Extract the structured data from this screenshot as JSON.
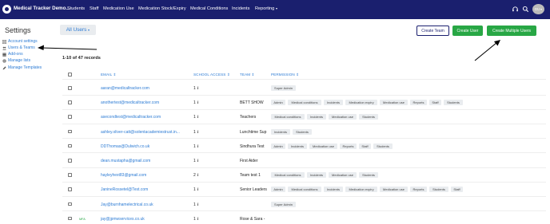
{
  "app": {
    "brand": "Medical Tracker Demo...",
    "nav": [
      "Students",
      "Staff",
      "Medication Use",
      "Medication Stock/Expiry",
      "Medical Conditions",
      "Incidents"
    ],
    "reporting": "Reporting",
    "avatar_initials": "GU"
  },
  "sidebar": {
    "title": "Settings",
    "items": [
      {
        "label": "Account settings",
        "icon": "list-icon"
      },
      {
        "label": "Users & Teams",
        "icon": "users-icon"
      },
      {
        "label": "Add-ons",
        "icon": "addons-icon"
      },
      {
        "label": "Manage lists",
        "icon": "gear-icon"
      },
      {
        "label": "Manage Templates",
        "icon": "pencil-icon"
      }
    ]
  },
  "filter": {
    "label": "All Users"
  },
  "actions": {
    "create_team": "Create Team",
    "create_user": "Create User",
    "create_multiple": "Create Multiple Users"
  },
  "record_count": "1-10 of 47 records",
  "table": {
    "headers": [
      "EMAIL",
      "SCHOOL ACCESS",
      "TEAM",
      "PERMISSION"
    ],
    "rows": [
      {
        "email": "aaran@medicaltracker.com",
        "access": "1",
        "team": "",
        "mfa": "",
        "perms": [
          "Super Admin"
        ]
      },
      {
        "email": "anothertest@medicaltracker.com",
        "access": "1",
        "team": "BETT SHOW",
        "mfa": "",
        "perms": [
          "Admin",
          "Medical conditions",
          "Incidents",
          "Medication expiry",
          "Medication use",
          "Reports",
          "Staff",
          "Students"
        ]
      },
      {
        "email": "asecondtest@medicaltracker.com",
        "access": "1",
        "team": "Teachers",
        "mfa": "",
        "perms": [
          "Medical conditions",
          "Incidents",
          "Medication use",
          "Students"
        ]
      },
      {
        "email": "ashley.oliver-catt@solentacademiestrust.in...",
        "access": "1",
        "team": "Lunchtime Sup",
        "mfa": "",
        "perms": [
          "Incidents",
          "Students"
        ]
      },
      {
        "email": "DDThomas@Dulwich.co.uk",
        "access": "1",
        "team": "Sindhura Test",
        "mfa": "",
        "perms": [
          "Admin",
          "Incidents",
          "Medication use",
          "Reports",
          "Staff",
          "Students"
        ]
      },
      {
        "email": "dean.mustapha@gmail.com",
        "access": "1",
        "team": "First Aider",
        "mfa": "",
        "perms": []
      },
      {
        "email": "hayleyhext83@gmail.com",
        "access": "2",
        "team": "Team test 1",
        "mfa": "",
        "perms": [
          "Medical conditions",
          "Incidents",
          "Medication use",
          "Students"
        ]
      },
      {
        "email": "JanineRossetel@Test.com",
        "access": "1",
        "team": "Senior Leaders",
        "mfa": "",
        "perms": [
          "Admin",
          "Medical conditions",
          "Incidents",
          "Medication expiry",
          "Medication use",
          "Reports",
          "Students",
          "Staff"
        ]
      },
      {
        "email": "Jay@burnhamelectrical.co.uk",
        "access": "1",
        "team": "",
        "mfa": "",
        "perms": [
          "Super Admin"
        ]
      },
      {
        "email": "jay@jpmwservices.co.uk",
        "access": "1",
        "team": "Rose & Sara -",
        "mfa": "MFA",
        "perms": []
      }
    ]
  },
  "colors": {
    "nav_bg": "#1a1f6e",
    "link": "#2c7bd4",
    "green": "#28a745",
    "tag_bg": "#e9ecef"
  }
}
